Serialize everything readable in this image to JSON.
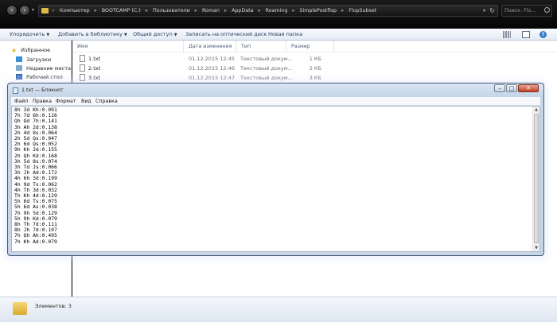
{
  "explorer": {
    "breadcrumbs": [
      "Компьютер",
      "BOOTCAMP (C:)",
      "Пользователи",
      "Roman",
      "AppData",
      "Roaming",
      "SimplePostflop",
      "FlopSubset"
    ],
    "search_placeholder": "Поиск: Flo...",
    "toolbar": {
      "organize": "Упорядочить",
      "add_library": "Добавить в библиотеку",
      "share": "Общий доступ",
      "burn": "Записать на оптический диск",
      "new_folder": "Новая папка"
    },
    "nav_pane": {
      "favorites": "Избранное",
      "downloads": "Загрузки",
      "recent": "Недавние места",
      "desktop": "Рабочий стол"
    },
    "columns": {
      "name": "Имя",
      "date": "Дата изменения",
      "type": "Тип",
      "size": "Размер"
    },
    "files": [
      {
        "name": "1.txt",
        "date": "01.12.2015 12:45",
        "type": "Текстовый докум...",
        "size": "1 КБ"
      },
      {
        "name": "2.txt",
        "date": "01.12.2015 12:46",
        "type": "Текстовый докум...",
        "size": "2 КБ"
      },
      {
        "name": "3.txt",
        "date": "01.12.2015 12:47",
        "type": "Текстовый докум...",
        "size": "3 КБ"
      }
    ],
    "status": "Элементов: 3"
  },
  "notepad": {
    "title": "1.txt — Блокнот",
    "menu": [
      "Файл",
      "Правка",
      "Формат",
      "Вид",
      "Справка"
    ],
    "lines": [
      "8h 3d Kh:0.091",
      "7h 7d 6h:0.116",
      "Qh Qd 7h:0.141",
      "3h Ah 2d:0.138",
      "2h 4d 8s:0.064",
      "2h 5d Qs:0.047",
      "2h 6d Qs:0.052",
      "9h Kh 2d:0.155",
      "2h Qh Kd:0.168",
      "3h 5d 8s:0.074",
      "3h Td Js:0.066",
      "3h Jh Ad:0.172",
      "4h 6h 3d:0.199",
      "4h 9d Ts:0.062",
      "4h Th 3d:0.032",
      "Th Kh 4d:0.129",
      "5h 6d Ts:0.075",
      "5h 6d As:0.038",
      "7h 9h 5d:0.129",
      "5h 9h Kd:0.079",
      "8h Th 7d:0.111",
      "8h Jh 7d:0.107",
      "7h Qh Ah:0.495",
      "7h Kh Ad:0.079"
    ]
  }
}
